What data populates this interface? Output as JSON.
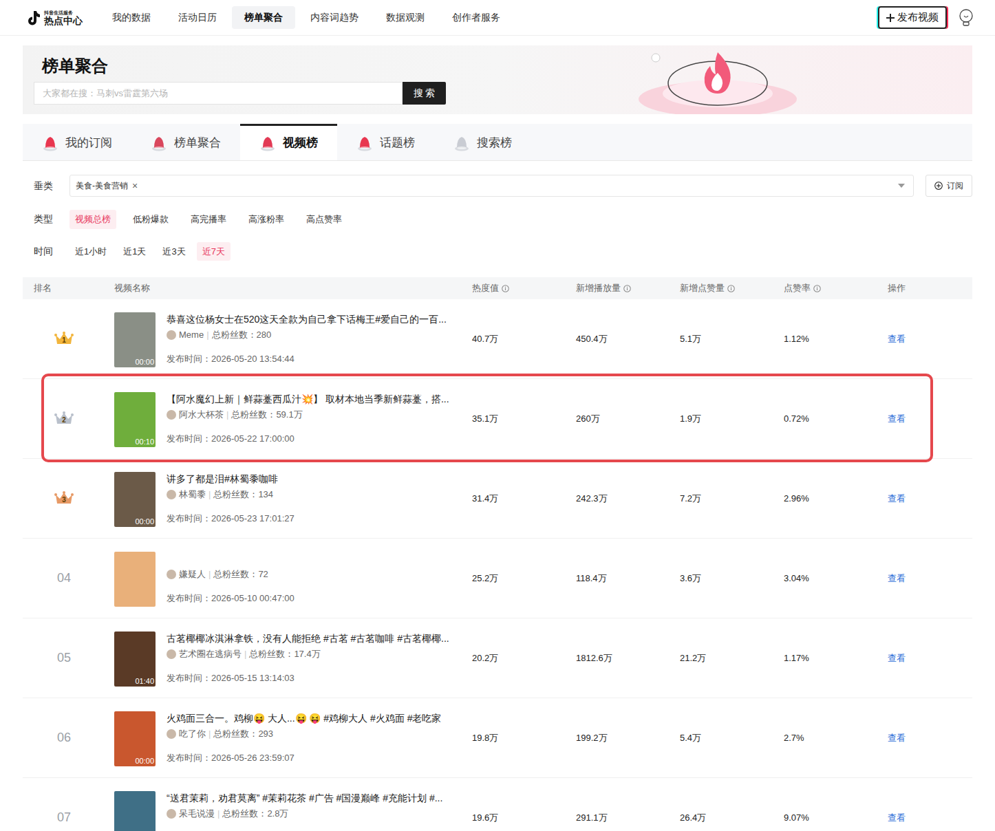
{
  "app": {
    "logo_top": "抖音生活服务",
    "logo_main": "热点中心"
  },
  "nav": [
    {
      "label": "我的数据",
      "selected": false
    },
    {
      "label": "活动日历",
      "selected": false
    },
    {
      "label": "榜单聚合",
      "selected": true
    },
    {
      "label": "内容词趋势",
      "selected": false
    },
    {
      "label": "数据观测",
      "selected": false
    },
    {
      "label": "创作者服务",
      "selected": false
    }
  ],
  "publish_button": "发布视频",
  "banner": {
    "title": "榜单聚合",
    "search_placeholder": "大家都在搜：马刺vs雷霆第六场",
    "search_button": "搜 索"
  },
  "tabs": [
    {
      "label": "我的订阅",
      "selected": false
    },
    {
      "label": "榜单聚合",
      "selected": false
    },
    {
      "label": "视频榜",
      "selected": true
    },
    {
      "label": "话题榜",
      "selected": false
    },
    {
      "label": "搜索榜",
      "selected": false
    }
  ],
  "filters": {
    "category_label": "垂类",
    "category_tags": [
      {
        "label": "美食-美食营销",
        "remove": "×"
      }
    ],
    "subscribe": "订阅",
    "type_label": "类型",
    "types": [
      {
        "label": "视频总榜",
        "selected": true
      },
      {
        "label": "低粉爆款",
        "selected": false
      },
      {
        "label": "高完播率",
        "selected": false
      },
      {
        "label": "高涨粉率",
        "selected": false
      },
      {
        "label": "高点赞率",
        "selected": false
      }
    ],
    "time_label": "时间",
    "times": [
      {
        "label": "近1小时",
        "selected": false
      },
      {
        "label": "近1天",
        "selected": false
      },
      {
        "label": "近3天",
        "selected": false
      },
      {
        "label": "近7天",
        "selected": true
      }
    ]
  },
  "table": {
    "columns": [
      {
        "label": "排名",
        "info": false
      },
      {
        "label": "视频名称",
        "info": false
      },
      {
        "label": "热度值",
        "info": true
      },
      {
        "label": "新增播放量",
        "info": true
      },
      {
        "label": "新增点赞量",
        "info": true
      },
      {
        "label": "点赞率",
        "info": true
      },
      {
        "label": "操作",
        "info": false
      }
    ],
    "separator": "|",
    "fans_label": "总粉丝数：",
    "time_label": "发布时间：",
    "action": "查看",
    "rows": [
      {
        "rank": "1",
        "kind": "crown",
        "color": "#f2b53c",
        "thumb_color": "#8a8f86",
        "duration": "00:00",
        "title": "恭喜这位杨女士在520这天全款为自己拿下话梅王#爱自己的一百...",
        "author": "Meme",
        "fans": "280",
        "time": "2026-05-20 13:54:44",
        "heat": "40.7万",
        "plays": "450.4万",
        "likes": "5.1万",
        "rate": "1.12%",
        "highlighted": false
      },
      {
        "rank": "2",
        "kind": "crown",
        "color": "#b9c0cb",
        "thumb_color": "#6fae3c",
        "duration": "00:10",
        "title": "【阿水魔幻上新｜鲜蒜薹西瓜汁💥】 取材本地当季新鲜蒜薹，搭...",
        "author": "阿水大杯茶",
        "fans": "59.1万",
        "time": "2026-05-22 17:00:00",
        "heat": "35.1万",
        "plays": "260万",
        "likes": "1.9万",
        "rate": "0.72%",
        "highlighted": true
      },
      {
        "rank": "3",
        "kind": "crown",
        "color": "#e79a66",
        "thumb_color": "#6b5a48",
        "duration": "00:00",
        "title": "讲多了都是泪#林蜀黍咖啡",
        "author": "林蜀黍",
        "fans": "134",
        "time": "2026-05-23 17:01:27",
        "heat": "31.4万",
        "plays": "242.3万",
        "likes": "7.2万",
        "rate": "2.96%",
        "highlighted": false
      },
      {
        "rank": "04",
        "kind": "number",
        "color": "#9aa0a6",
        "thumb_color": "#e9b07a",
        "author": "嫌疑人",
        "fans": "72",
        "time": "2026-05-10 00:47:00",
        "heat": "25.2万",
        "plays": "118.4万",
        "likes": "3.6万",
        "rate": "3.04%",
        "highlighted": false
      },
      {
        "rank": "05",
        "kind": "number",
        "color": "#9aa0a6",
        "thumb_color": "#5a3a26",
        "duration": "01:40",
        "title": "古茗椰椰冰淇淋拿铁，没有人能拒绝 #古茗 #古茗咖啡 #古茗椰椰...",
        "author": "艺术圈在逃病号",
        "fans": "17.4万",
        "time": "2026-05-15 13:14:03",
        "heat": "20.2万",
        "plays": "1812.6万",
        "likes": "21.2万",
        "rate": "1.17%",
        "highlighted": false
      },
      {
        "rank": "06",
        "kind": "number",
        "color": "#9aa0a6",
        "thumb_color": "#c9572e",
        "duration": "00:00",
        "title": "火鸡面三合一。鸡柳😝 大人...😝 😝 #鸡柳大人 #火鸡面 #老吃家",
        "author": "吃了你",
        "fans": "293",
        "time": "2026-05-26 23:59:07",
        "heat": "19.8万",
        "plays": "199.2万",
        "likes": "5.4万",
        "rate": "2.7%",
        "highlighted": false
      },
      {
        "rank": "07",
        "kind": "number",
        "color": "#9aa0a6",
        "thumb_color": "#3f6f86",
        "title": "“送君茉莉，劝君莫离” #茉莉花茶 #广告 #国漫巅峰 #充能计划 #...",
        "author": "呆毛说漫",
        "fans": "2.8万",
        "heat": "19.6万",
        "plays": "291.1万",
        "likes": "26.4万",
        "rate": "9.07%",
        "highlighted": false
      }
    ]
  }
}
